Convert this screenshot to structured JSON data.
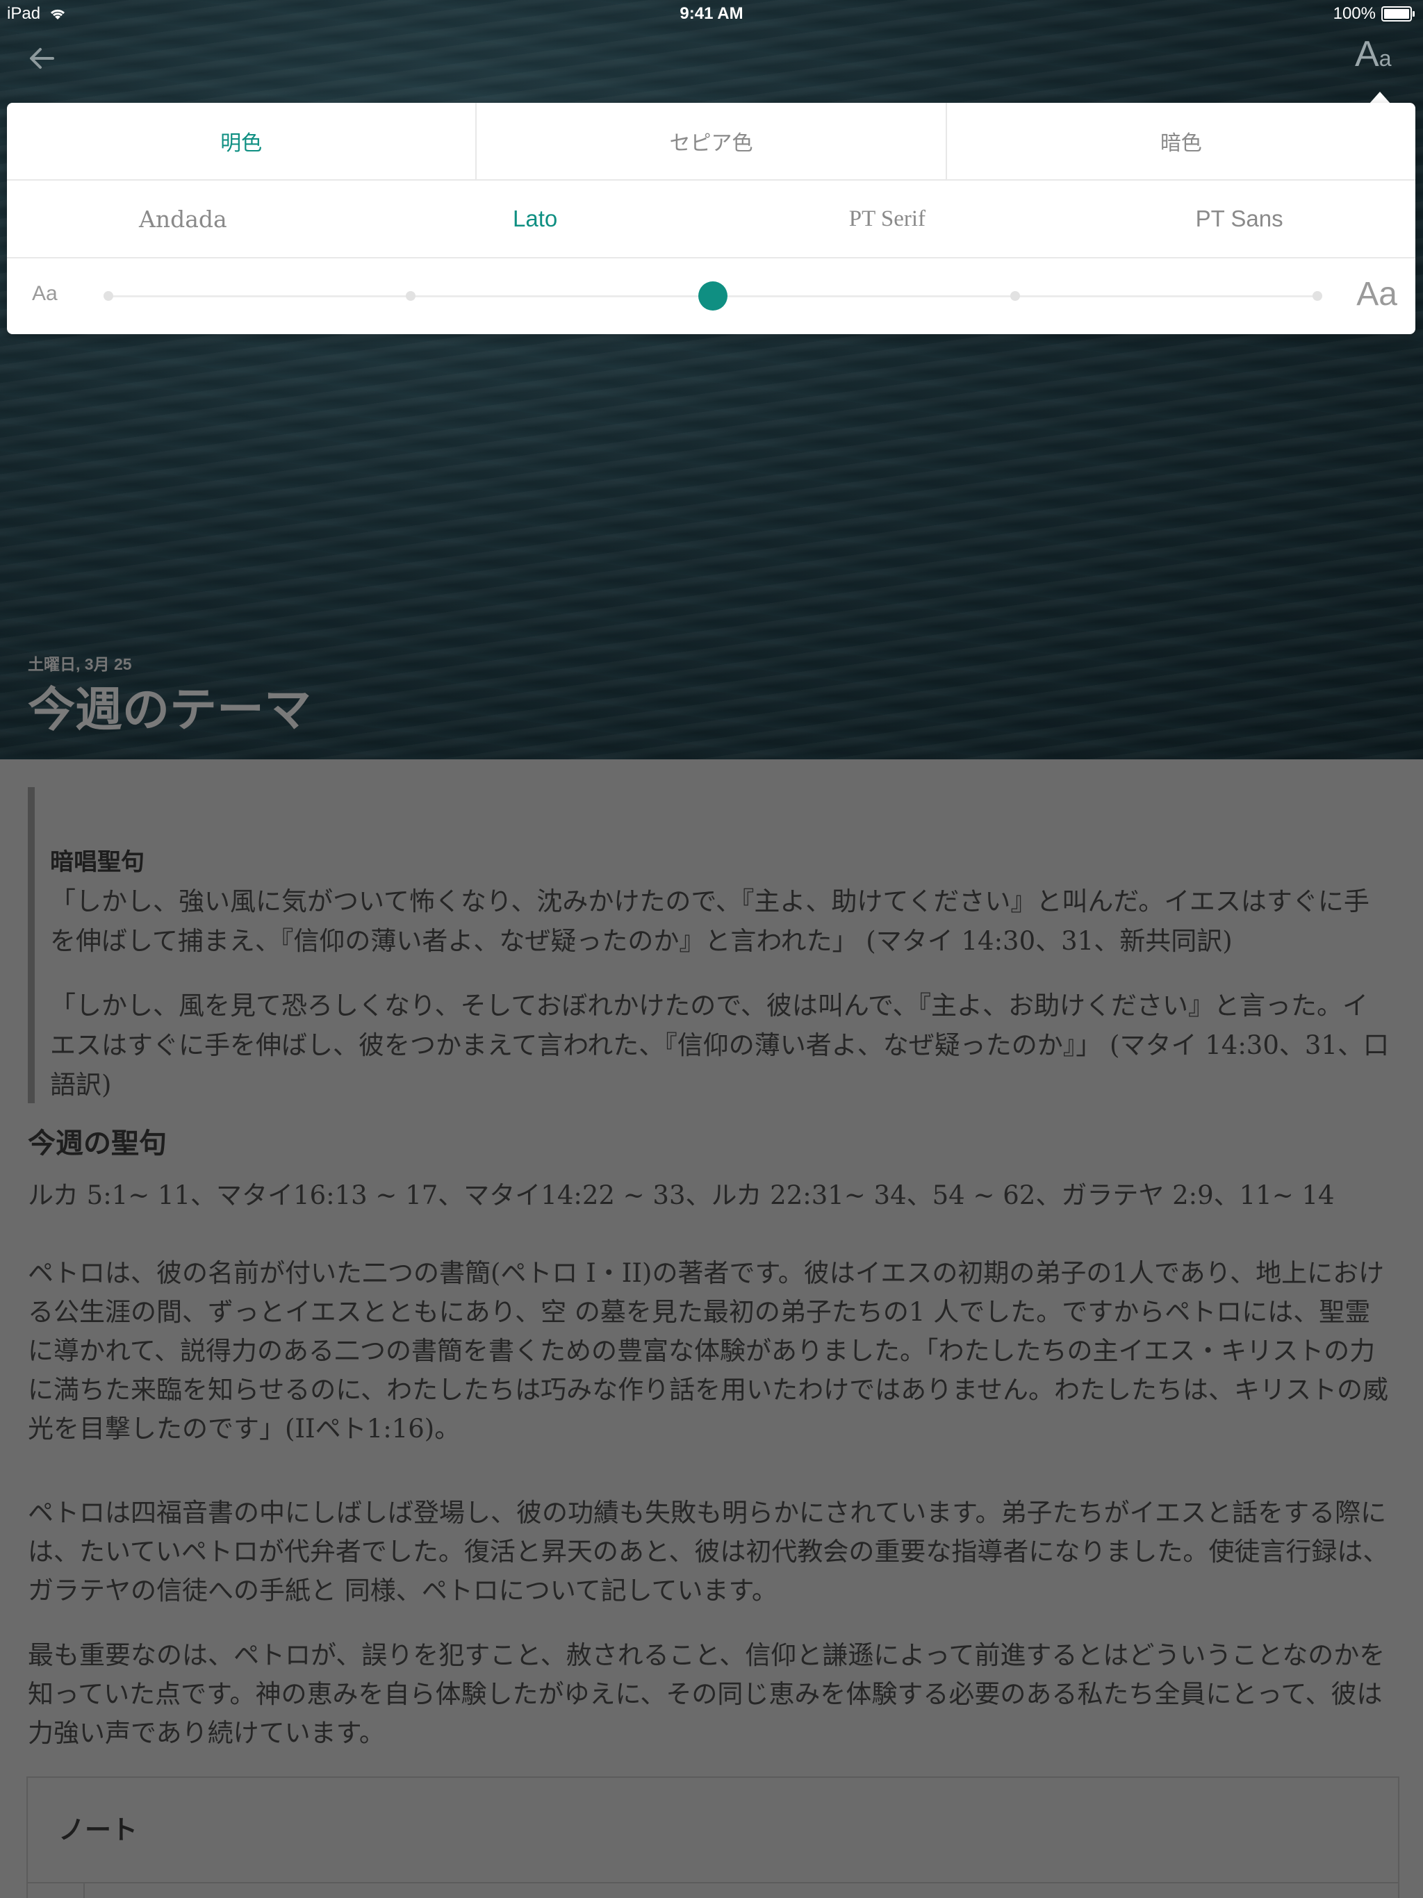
{
  "status_bar": {
    "device": "iPad",
    "time": "9:41 AM",
    "battery": "100%",
    "battery_level": 1.0
  },
  "nav": {
    "back_icon": "arrow-left-icon",
    "font_settings_big": "A",
    "font_settings_small": "a"
  },
  "settings": {
    "themes": [
      {
        "label": "明色",
        "active": true
      },
      {
        "label": "セピア色",
        "active": false
      },
      {
        "label": "暗色",
        "active": false
      }
    ],
    "fonts": [
      {
        "label": "Andada",
        "active": false
      },
      {
        "label": "Lato",
        "active": true
      },
      {
        "label": "PT Serif",
        "active": false
      },
      {
        "label": "PT Sans",
        "active": false
      }
    ],
    "size_small_label": "Aa",
    "size_large_label": "Aa",
    "size_steps": 5,
    "size_selected_index": 2,
    "accent_color": "#0f8f82"
  },
  "lesson": {
    "date": "土曜日, 3月 25",
    "title": "今週のテーマ",
    "memory_verse": {
      "heading": "暗唱聖句",
      "texts": [
        "「しかし、強い風に気がついて怖くなり、沈みかけたので、『主よ、助けてください』と叫んだ。イエスはすぐに手を伸ばして捕まえ、『信仰の薄い者よ、なぜ疑ったのか』と言われた」 (マタイ 14:30、31、新共同訳)",
        "「しかし、風を見て恐ろしくなり、そしておぼれかけたので、彼は叫んで、『主よ、お助けください』と言った。イエスはすぐに手を伸ばし、彼をつかまえて言われた、『信仰の薄い者よ、なぜ疑ったのか』」 (マタイ 14:30、31、口語訳)"
      ]
    },
    "reading_heading": "今週の聖句",
    "reading_refs": "ルカ 5:1~ 11、マタイ16:13 ~ 17、マタイ14:22 ~ 33、ルカ 22:31~ 34、54 ~ 62、ガラテヤ 2:9、11~ 14",
    "paragraphs": [
      "ペトロは、彼の名前が付いた二つの書簡(ペトロ I・II)の著者です。彼はイエスの初期の弟子の1人であり、地上における公生涯の間、ずっとイエスとともにあり、空 の墓を見た最初の弟子たちの1 人でした。ですからペトロには、聖霊に導かれて、説得力のある二つの書簡を書くための豊富な体験がありました。「わたしたちの主イエス・キリストの力に満ちた来臨を知らせるのに、わたしたちは巧みな作り話を用いたわけではありません。わたしたちは、キリストの威光を目撃したのです」(IIペト1:16)。",
      "ペトロは四福音書の中にしばしば登場し、彼の功績も失敗も明らかにされています。弟子たちがイエスと話をする際には、たいていペトロが代弁者でした。復活と昇天のあと、彼は初代教会の重要な指導者になりました。使徒言行録は、ガラテヤの信徒への手紙と 同様、ペトロについて記しています。",
      "最も重要なのは、ペトロが、誤りを犯すこと、赦されること、信仰と謙遜によって前進するとはどういうことなのかを知っていた点です。神の恵みを自ら体験したがゆえに、その同じ恵みを体験する必要のある私たち全員にとって、彼は力強い声であり続けています。"
    ],
    "notes_heading": "ノート"
  }
}
